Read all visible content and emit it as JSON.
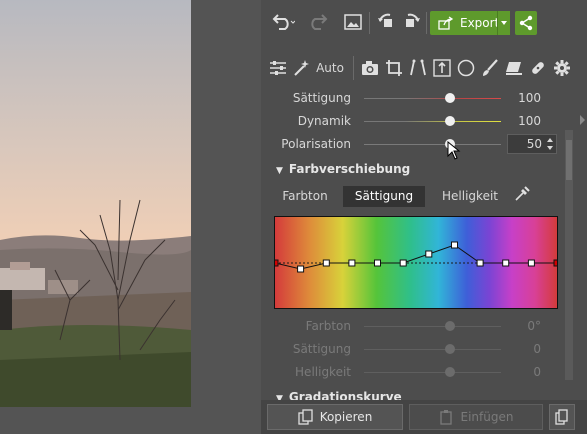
{
  "toolbar": {
    "undo_icon": "undo-icon",
    "redo_icon": "redo-icon",
    "image_icon": "image-icon",
    "rotate_left_icon": "rotate-left-icon",
    "rotate_right_icon": "rotate-right-icon",
    "export_label": "Export",
    "share_icon": "share-icon",
    "accent": "#5e9a2c"
  },
  "tools": {
    "auto_label": "Auto",
    "items": [
      "sliders-icon",
      "magic-wand-icon",
      "camera-icon",
      "crop-icon",
      "perspective-icon",
      "text-icon",
      "circle-icon",
      "brush-icon",
      "eraser-icon",
      "bandage-icon",
      "gear-icon"
    ]
  },
  "adjustments": {
    "saturation": {
      "label": "Sättigung",
      "value": "100"
    },
    "vibrance": {
      "label": "Dynamik",
      "value": "100"
    },
    "polarization": {
      "label": "Polarisation",
      "value": "50"
    }
  },
  "color_shift": {
    "section_title": "Farbverschiebung",
    "tabs": [
      "Farbton",
      "Sättigung",
      "Helligkeit"
    ],
    "active_tab": "Sättigung",
    "curve_points": [
      0,
      -0.1,
      0,
      0,
      0,
      0,
      0.15,
      0.3,
      0,
      0,
      0,
      0
    ],
    "sub_controls": {
      "hue": {
        "label": "Farbton",
        "value": "0°"
      },
      "saturation": {
        "label": "Sättigung",
        "value": "0"
      },
      "brightness": {
        "label": "Helligkeit",
        "value": "0"
      }
    }
  },
  "next_section": {
    "title": "Gradationskurve"
  },
  "bottom": {
    "copy_label": "Kopieren",
    "paste_label": "Einfügen"
  }
}
